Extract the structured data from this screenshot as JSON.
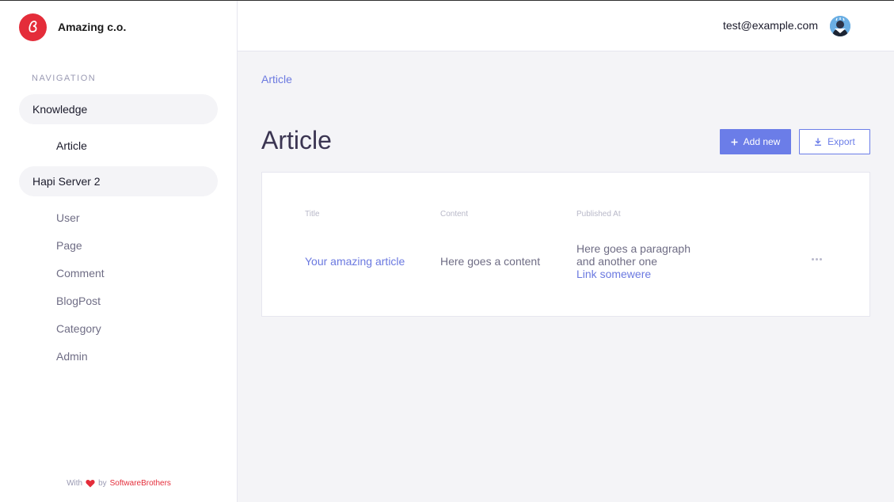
{
  "brand": {
    "name": "Amazing c.o.",
    "accent": "#e42d3a"
  },
  "navigation": {
    "title": "NAVIGATION",
    "groups": [
      {
        "label": "Knowledge",
        "items": [
          "Article"
        ]
      },
      {
        "label": "Hapi Server 2",
        "items": [
          "User",
          "Page",
          "Comment",
          "BlogPost",
          "Category",
          "Admin"
        ]
      }
    ]
  },
  "footer": {
    "prefix": "With",
    "suffix": "by",
    "company": "SoftwareBrothers"
  },
  "topbar": {
    "user_email": "test@example.com"
  },
  "breadcrumb": "Article",
  "page": {
    "title": "Article",
    "add_new_label": "Add new",
    "export_label": "Export"
  },
  "table": {
    "columns": [
      "Title",
      "Content",
      "Published At"
    ],
    "rows": [
      {
        "title": "Your amazing article",
        "content": "Here goes a content",
        "published_line1": "Here goes a paragraph",
        "published_line2": "and another one",
        "published_link": "Link somewere"
      }
    ]
  },
  "colors": {
    "primary": "#6b7de8",
    "sidebar_bg": "#ffffff",
    "content_bg": "#f4f4f7"
  }
}
